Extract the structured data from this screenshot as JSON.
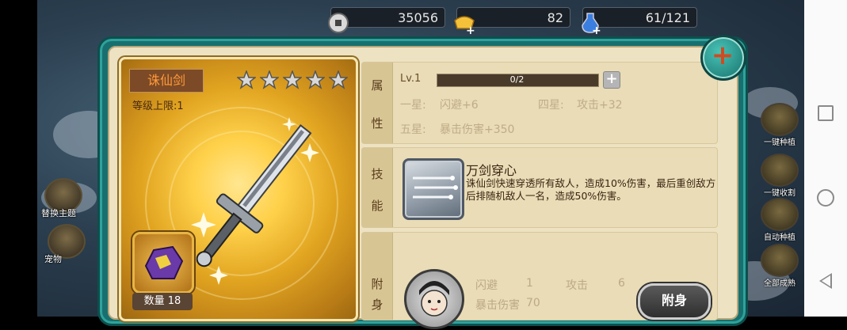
{
  "resources": {
    "coins": "35056",
    "gold": "82",
    "stamina": "61/121"
  },
  "left_icons": [
    {
      "label": "替换主题",
      "icon": "theme-icon"
    },
    {
      "label": "宠物",
      "icon": "pet-icon"
    }
  ],
  "right_icons": [
    {
      "label": "一键种植",
      "icon": "plant-icon"
    },
    {
      "label": "一键收割",
      "icon": "harvest-icon"
    },
    {
      "label": "自动种植",
      "icon": "auto-plant-icon"
    },
    {
      "label": "全部成熟",
      "icon": "ripen-icon"
    }
  ],
  "item": {
    "name": "诛仙剑",
    "level_cap": "等级上限:1",
    "stars": 5,
    "quantity_label": "数量 18"
  },
  "attributes": {
    "tag": [
      "属",
      "性"
    ],
    "level_label": "Lv.1",
    "progress_text": "0/2",
    "progress": 0,
    "rows": [
      {
        "star": "一星:",
        "value": "闪避+6"
      },
      {
        "star": "四星:",
        "value": "攻击+32"
      },
      {
        "star": "五星:",
        "value": "暴击伤害+350"
      }
    ]
  },
  "skill": {
    "tag": [
      "技",
      "能"
    ],
    "name": "万剑穿心",
    "description": "诛仙剑快速穿透所有敌人，造成10%伤害，最后重创敌方后排随机敌人一名，造成50%伤害。"
  },
  "attach": {
    "tag": [
      "附",
      "身"
    ],
    "stats": [
      {
        "label": "闪避",
        "value": "1"
      },
      {
        "label": "攻击",
        "value": "6"
      },
      {
        "label": "暴击伤害",
        "value": "70"
      }
    ],
    "button_label": "附身"
  },
  "colors": {
    "frame": "#17706f",
    "panel": "#ede2c2",
    "card_gold": "#ffd14a",
    "name_text": "#ff9a3a"
  }
}
